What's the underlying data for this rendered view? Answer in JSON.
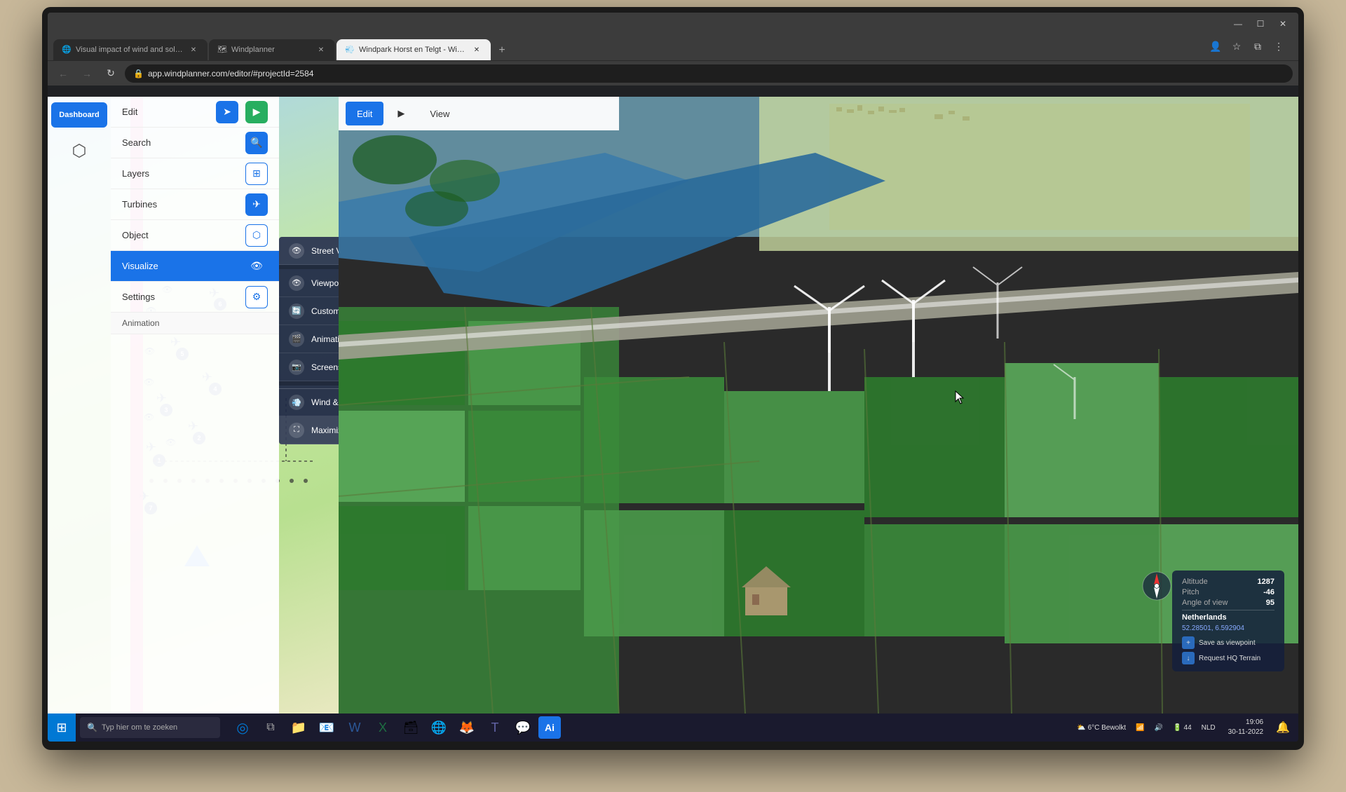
{
  "browser": {
    "tabs": [
      {
        "id": "tab1",
        "title": "Visual impact of wind and solar...",
        "favicon": "🌐",
        "active": false
      },
      {
        "id": "tab2",
        "title": "Windplanner",
        "favicon": "🗺",
        "active": false
      },
      {
        "id": "tab3",
        "title": "Windpark Horst en Telgt - Wind...",
        "favicon": "💨",
        "active": true
      }
    ],
    "address": "app.windplanner.com/editor/#projectId=2584",
    "window_controls": {
      "minimize": "—",
      "maximize": "☐",
      "close": "✕"
    }
  },
  "app": {
    "dashboard_label": "Dashboard",
    "toolbar": {
      "edit_label": "Edit",
      "play_label": "▶",
      "view_label": "View"
    },
    "menu_items": [
      {
        "id": "edit",
        "label": "Edit"
      },
      {
        "id": "search",
        "label": "Search"
      },
      {
        "id": "layers",
        "label": "Layers"
      },
      {
        "id": "turbines",
        "label": "Turbines"
      },
      {
        "id": "object",
        "label": "Object"
      },
      {
        "id": "visualize",
        "label": "Visualize",
        "active": true
      },
      {
        "id": "settings",
        "label": "Settings"
      },
      {
        "id": "animation",
        "label": "Animation"
      }
    ],
    "visualize_submenu": [
      {
        "id": "street_view",
        "label": "Street View tool",
        "icon": "👁"
      },
      {
        "id": "viewpoint_list",
        "label": "Viewpoint list",
        "icon": "👁"
      },
      {
        "id": "custom_panos",
        "label": "Custom panos",
        "icon": "🔄"
      },
      {
        "id": "animation",
        "label": "Animation",
        "icon": "🎬"
      },
      {
        "id": "screenshots",
        "label": "Screenshots",
        "icon": "📷"
      },
      {
        "id": "wind_time",
        "label": "Wind & Time",
        "icon": "💨"
      },
      {
        "id": "maximize",
        "label": "Maximize",
        "icon": "⛶"
      }
    ],
    "info_panel": {
      "altitude_label": "Altitude",
      "altitude_value": "1287",
      "pitch_label": "Pitch",
      "pitch_value": "-46",
      "angle_of_view_label": "Angle of view",
      "angle_of_view_value": "95",
      "country_label": "Netherlands",
      "coords": "52.28501, 6.592904",
      "save_viewpoint": "Save as viewpoint",
      "request_hq": "Request HQ Terrain"
    }
  },
  "taskbar": {
    "search_placeholder": "Typ hier om te zoeken",
    "weather": "6°C Bewolkt",
    "battery": "44",
    "language": "NLD",
    "time": "19:06",
    "date": "30-11-2022",
    "apps": [
      "⊞",
      "🔍",
      "📁",
      "📧",
      "📝",
      "📗",
      "🗃",
      "🌐",
      "🦊",
      "🔷",
      "💬",
      "🎵"
    ]
  }
}
